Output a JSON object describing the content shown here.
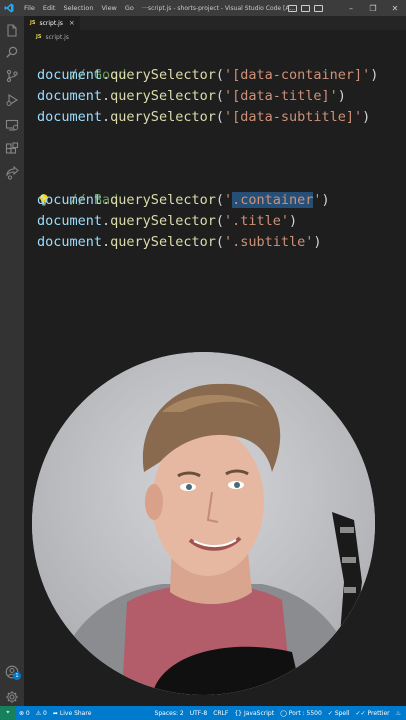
{
  "titlebar": {
    "menus": [
      "File",
      "Edit",
      "Selection",
      "View",
      "Go",
      "···"
    ],
    "window_title": "script.js - shorts-project - Visual Studio Code [A...",
    "controls": [
      "–",
      "❐",
      "✕"
    ]
  },
  "activitybar": {
    "icons": [
      "explorer-icon",
      "search-icon",
      "source-control-icon",
      "run-debug-icon",
      "remote-explorer-icon",
      "extensions-icon",
      "live-share-icon",
      "account-icon",
      "settings-gear-icon"
    ],
    "account_badge": "1"
  },
  "tab": {
    "badge": "JS",
    "label": "script.js",
    "close": "×"
  },
  "breadcrumb": {
    "badge": "JS",
    "label": "script.js"
  },
  "code": {
    "good_comment": "// Good",
    "bad_comment": "// Bad",
    "obj": "document",
    "dot": ".",
    "fn": "querySelector",
    "open_paren": "(",
    "close_paren": ")",
    "good_selectors": [
      "'[data-container]'",
      "'[data-title]'",
      "'[data-subtitle]'"
    ],
    "bad_quote": "'",
    "bad_highlighted": ".container",
    "bad_selectors_rest": [
      "'.title'",
      "'.subtitle'"
    ]
  },
  "statusbar": {
    "errors": "⊗ 0",
    "warnings": "⚠ 0",
    "live_share": "Live Share",
    "spaces": "Spaces: 2",
    "encoding": "UTF-8",
    "eol": "CRLF",
    "language": "JavaScript",
    "port": "Port : 5500",
    "spell": "Spell",
    "prettier": "Prettier"
  },
  "colors": {
    "accent": "#007acc",
    "keyword_fn": "#dcdcaa",
    "string": "#ce9178",
    "comment": "#6a9955",
    "selection": "#264f78"
  }
}
